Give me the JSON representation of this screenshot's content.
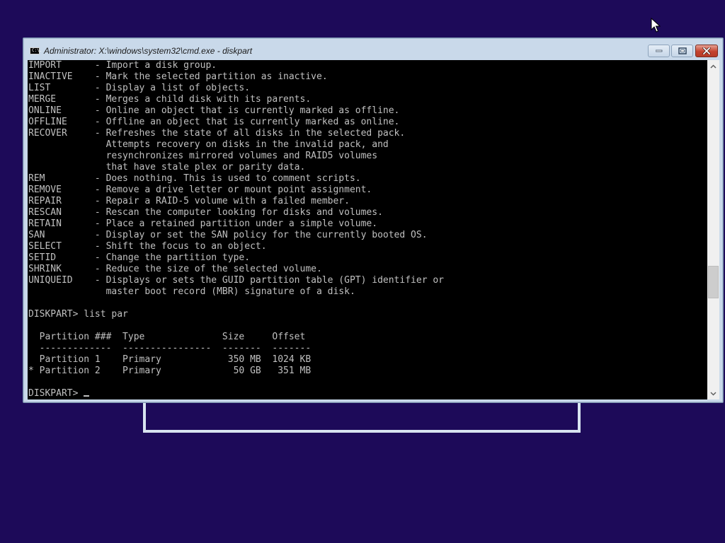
{
  "window": {
    "title": "Administrator: X:\\windows\\system32\\cmd.exe - diskpart",
    "icon_text": "C:\\."
  },
  "console": {
    "lines": [
      "IMPORT      - Import a disk group.",
      "INACTIVE    - Mark the selected partition as inactive.",
      "LIST        - Display a list of objects.",
      "MERGE       - Merges a child disk with its parents.",
      "ONLINE      - Online an object that is currently marked as offline.",
      "OFFLINE     - Offline an object that is currently marked as online.",
      "RECOVER     - Refreshes the state of all disks in the selected pack.",
      "              Attempts recovery on disks in the invalid pack, and",
      "              resynchronizes mirrored volumes and RAID5 volumes",
      "              that have stale plex or parity data.",
      "REM         - Does nothing. This is used to comment scripts.",
      "REMOVE      - Remove a drive letter or mount point assignment.",
      "REPAIR      - Repair a RAID-5 volume with a failed member.",
      "RESCAN      - Rescan the computer looking for disks and volumes.",
      "RETAIN      - Place a retained partition under a simple volume.",
      "SAN         - Display or set the SAN policy for the currently booted OS.",
      "SELECT      - Shift the focus to an object.",
      "SETID       - Change the partition type.",
      "SHRINK      - Reduce the size of the selected volume.",
      "UNIQUEID    - Displays or sets the GUID partition table (GPT) identifier or",
      "              master boot record (MBR) signature of a disk.",
      "",
      "DISKPART> list par",
      "",
      "  Partition ###  Type              Size     Offset",
      "  -------------  ----------------  -------  -------",
      "  Partition 1    Primary            350 MB  1024 KB",
      "* Partition 2    Primary             50 GB   351 MB",
      ""
    ],
    "prompt": "DISKPART> "
  },
  "colors": {
    "desktop": "#1d0a59",
    "console_bg": "#000000",
    "console_fg": "#c0c0c0",
    "close_button": "#c4432e"
  }
}
